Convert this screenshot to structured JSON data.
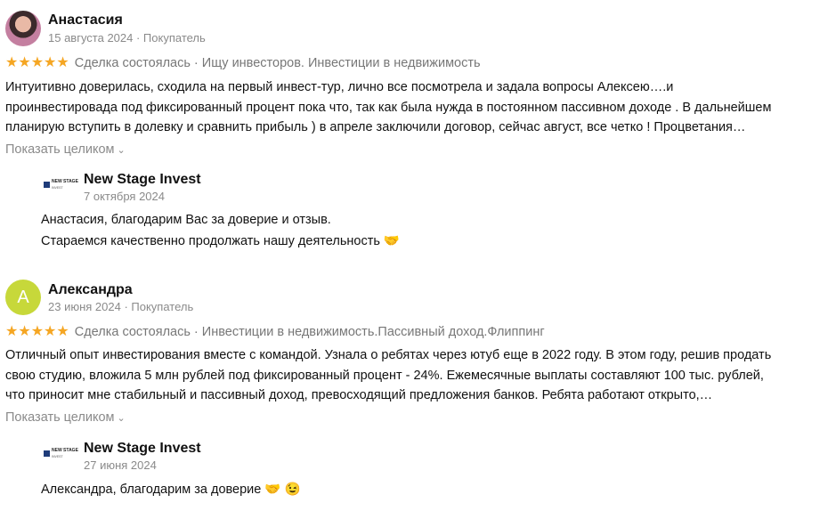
{
  "reviews": [
    {
      "author": "Анастасия",
      "avatar_letter": "",
      "meta": "15 августа 2024 · Покупатель",
      "stars": "★★★★★",
      "rating": 5,
      "tags": "Сделка состоялась · Ищу инвесторов. Инвестиции в недвижимость",
      "text_lines": [
        "Интуитивно доверилась, сходила на первый инвест-тур, лично все посмотрела и задала вопросы Алексею….и",
        "проинвестировада под фиксированный процент пока что, так как была нужда в постоянном пассивном доходе . В дальнейшем",
        "планирую вступить в долевку и сравнить прибыль ) в апреле заключили договор, сейчас август, все четко ! Процветания…"
      ],
      "expand_label": "Показать целиком",
      "reply": {
        "company": "New Stage Invest",
        "logo_text": "NEW STAGE",
        "logo_sub": "INVEST",
        "date": "7 октября 2024",
        "lines": [
          "Анастасия, благодарим Вас за доверие и отзыв.",
          "Стараемся качественно продолжать нашу деятельность 🤝"
        ]
      }
    },
    {
      "author": "Александра",
      "avatar_letter": "А",
      "meta": "23 июня 2024 · Покупатель",
      "stars": "★★★★★",
      "rating": 5,
      "tags": "Сделка состоялась · Инвестиции в недвижимость.Пассивный доход.Флиппинг",
      "text_lines": [
        "Отличный опыт инвестирования вместе с командой. Узнала о ребятах через ютуб еще в 2022 году. В этом году, решив продать",
        "свою студию, вложила 5 млн рублей под фиксированный процент - 24%. Ежемесячные выплаты составляют 100 тыс. рублей,",
        "что приносит мне стабильный и пассивный доход, превосходящий предложения банков. Ребята работают открыто,…"
      ],
      "expand_label": "Показать целиком",
      "reply": {
        "company": "New Stage Invest",
        "logo_text": "NEW STAGE",
        "logo_sub": "INVEST",
        "date": "27 июня 2024",
        "lines": [
          "Александра, благодарим за доверие 🤝 😉"
        ]
      }
    }
  ],
  "colors": {
    "stars": "#f5a623",
    "muted": "#8a8a8a",
    "avatar_letter_bg": "#c7d83a",
    "logo_accent": "#1f3c7a"
  }
}
